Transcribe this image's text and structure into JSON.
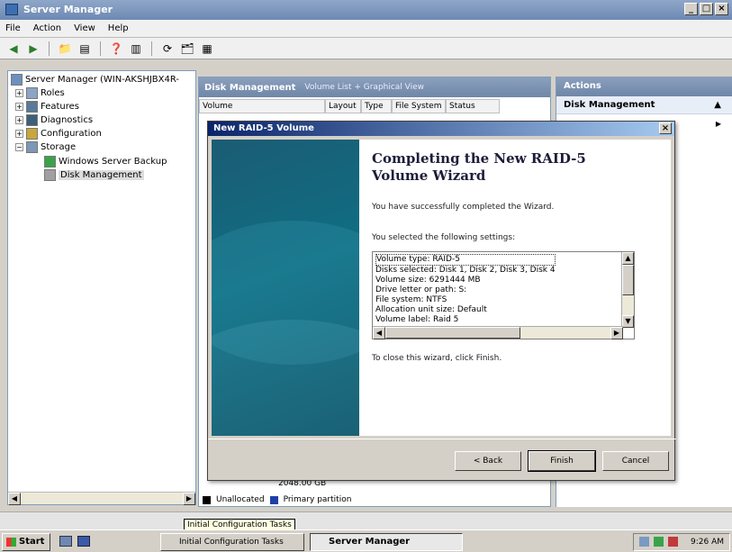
{
  "window": {
    "title": "Server Manager",
    "buttons": [
      "_",
      "□",
      "×"
    ]
  },
  "menu": [
    "File",
    "Action",
    "View",
    "Help"
  ],
  "tree": {
    "root": "Server Manager (WIN-AKSHJBX4R-",
    "items": [
      "Roles",
      "Features",
      "Diagnostics",
      "Configuration",
      "Storage"
    ],
    "storage_children": [
      "Windows Server Backup",
      "Disk Management"
    ]
  },
  "center": {
    "title": "Disk Management",
    "subtitle": "Volume List + Graphical View",
    "columns": [
      "Volume",
      "Layout",
      "Type",
      "File System",
      "Status"
    ],
    "legend": [
      "Unallocated",
      "Primary partition"
    ],
    "partial_size": "2048.00 GB",
    "colors": {
      "unallocated": "#000000",
      "primary": "#1f3fa8"
    }
  },
  "actions": {
    "title": "Actions",
    "section": "Disk Management"
  },
  "dialog": {
    "title": "New RAID-5 Volume",
    "heading": "Completing the New RAID-5 Volume Wizard",
    "success": "You have successfully completed the Wizard.",
    "selected_label": "You selected the following settings:",
    "settings": [
      "Volume type: RAID-5",
      "Disks selected: Disk 1, Disk 2, Disk 3, Disk 4",
      "Volume size: 6291444 MB",
      "Drive letter or path: S:",
      "File system: NTFS",
      "Allocation unit size: Default",
      "Volume label: Raid 5"
    ],
    "close_hint": "To close this wizard, click Finish.",
    "buttons": {
      "back": "< Back",
      "finish": "Finish",
      "cancel": "Cancel"
    }
  },
  "taskbar": {
    "start": "Start",
    "tooltip": "Initial Configuration Tasks",
    "tasks": [
      "Initial Configuration Tasks",
      "Server Manager"
    ],
    "clock": "9:26 AM"
  }
}
